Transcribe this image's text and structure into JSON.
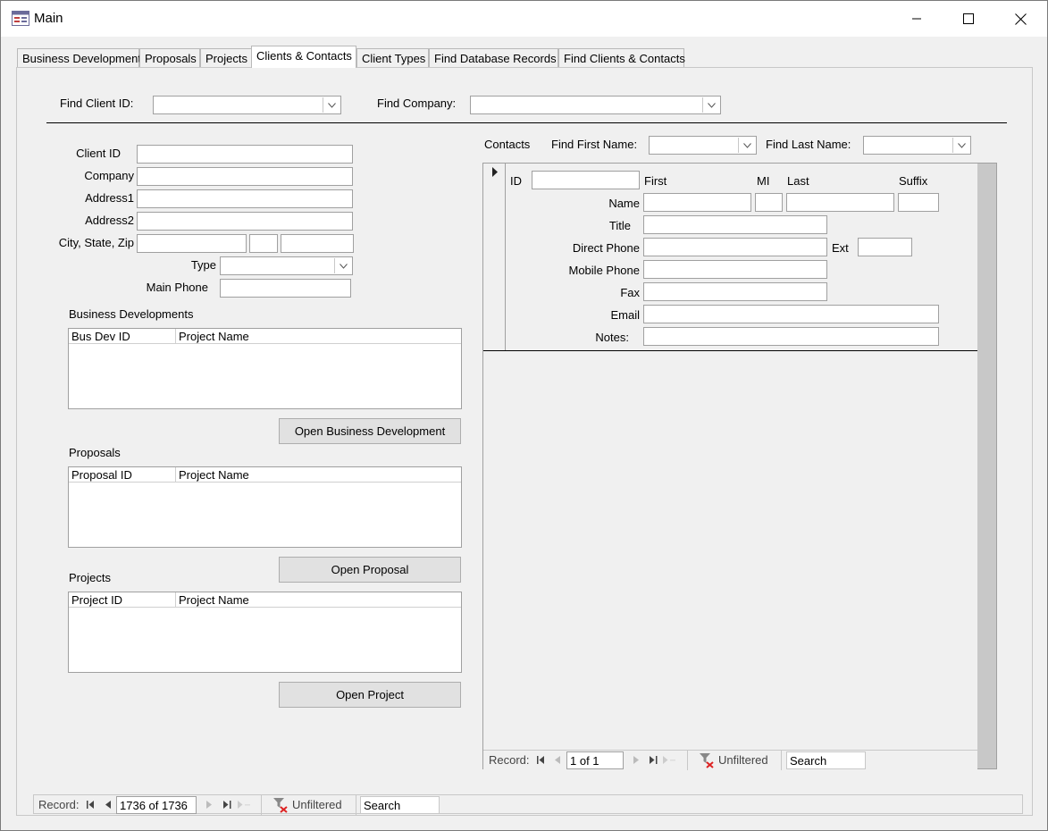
{
  "window": {
    "title": "Main"
  },
  "tabs": [
    {
      "label": "Business Development"
    },
    {
      "label": "Proposals"
    },
    {
      "label": "Projects"
    },
    {
      "label": "Clients & Contacts"
    },
    {
      "label": "Client Types"
    },
    {
      "label": "Find Database Records"
    },
    {
      "label": "Find Clients & Contacts"
    }
  ],
  "active_tab": "Clients & Contacts",
  "find": {
    "client_id_label": "Find Client ID:",
    "client_id_value": "",
    "company_label": "Find Company:",
    "company_value": ""
  },
  "client": {
    "client_id_label": "Client ID",
    "company_label": "Company",
    "address1_label": "Address1",
    "address2_label": "Address2",
    "city_state_zip_label": "City, State, Zip",
    "type_label": "Type",
    "main_phone_label": "Main Phone",
    "client_id": "",
    "company": "",
    "address1": "",
    "address2": "",
    "city": "",
    "state": "",
    "zip": "",
    "type": "",
    "main_phone": ""
  },
  "business_developments": {
    "label": "Business Developments",
    "columns": [
      "Bus Dev ID",
      "Project Name"
    ],
    "rows": [],
    "button": "Open Business Development"
  },
  "proposals": {
    "label": "Proposals",
    "columns": [
      "Proposal ID",
      "Project Name"
    ],
    "rows": [],
    "button": "Open Proposal"
  },
  "projects": {
    "label": "Projects",
    "columns": [
      "Project ID",
      "Project Name"
    ],
    "rows": [],
    "button": "Open Project"
  },
  "contacts": {
    "label": "Contacts",
    "find_first_label": "Find First Name:",
    "find_first_value": "",
    "find_last_label": "Find Last Name:",
    "find_last_value": "",
    "id_label": "ID",
    "first_label": "First",
    "mi_label": "MI",
    "last_label": "Last",
    "suffix_label": "Suffix",
    "name_label": "Name",
    "title_label": "Title",
    "direct_phone_label": "Direct Phone",
    "ext_label": "Ext",
    "mobile_phone_label": "Mobile Phone",
    "fax_label": "Fax",
    "email_label": "Email",
    "notes_label": "Notes:",
    "navigator": {
      "record_label": "Record:",
      "position": "1 of 1",
      "filter": "Unfiltered",
      "search": "Search"
    }
  },
  "main_navigator": {
    "record_label": "Record:",
    "position": "1736 of 1736",
    "filter": "Unfiltered",
    "search": "Search"
  },
  "icons": {
    "app": "form-icon",
    "minimize": "minimize-icon",
    "maximize": "maximize-icon",
    "close": "close-icon",
    "dropdown": "chevron-down-icon",
    "record_selector": "record-selector-arrow-icon",
    "first": "first-record-icon",
    "prev": "previous-record-icon",
    "next": "next-record-icon",
    "last": "last-record-icon",
    "new": "new-record-icon",
    "filter": "filter-icon"
  }
}
